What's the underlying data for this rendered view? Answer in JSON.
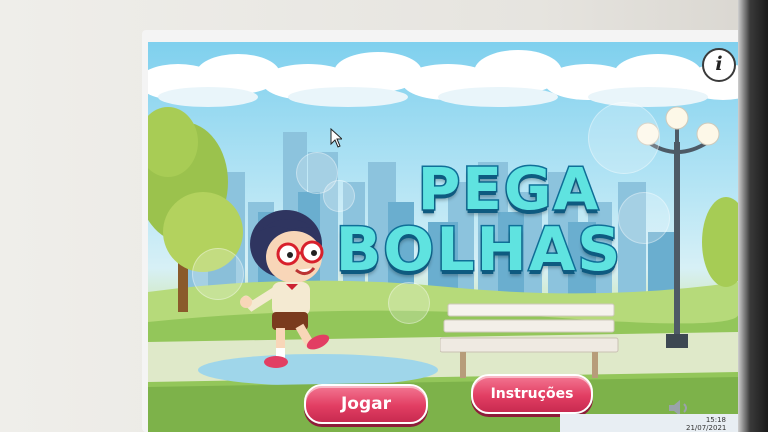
{
  "game": {
    "title_line1": "PEGA",
    "title_line2": "BOLHAS"
  },
  "buttons": {
    "play_label": "Jogar",
    "instructions_label": "Instruções",
    "info_label": "i"
  },
  "taskbar": {
    "time": "15:18",
    "date": "21/07/2021"
  },
  "colors": {
    "button_pink": "#e23e63",
    "title_cyan": "#5fe3e0",
    "title_outline": "#0f6f98",
    "sky": "#7fd0ee",
    "grass": "#8ec45e"
  },
  "icons": [
    "info-icon",
    "mouse-cursor-icon",
    "speaker-icon"
  ]
}
